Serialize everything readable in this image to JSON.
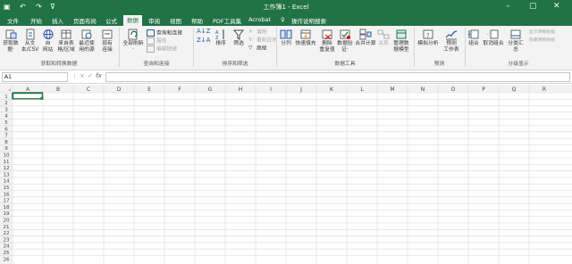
{
  "titlebar": {
    "title": "工作簿1 - Excel",
    "qat": [
      "save-icon",
      "undo-icon",
      "redo-icon",
      "customize-icon"
    ],
    "window_controls": [
      "minimize-icon",
      "restore-icon",
      "close-icon"
    ],
    "colors": {
      "accent": "#217346",
      "ribbon": "#f3f3f3"
    }
  },
  "tabs": [
    "文件",
    "开始",
    "插入",
    "页面布局",
    "公式",
    "数据",
    "审阅",
    "视图",
    "帮助",
    "PDF工具集",
    "Acrobat"
  ],
  "active_tab": "数据",
  "tell_me": "操作说明搜索",
  "ribbon": {
    "groups": {
      "get_transform": "获取和转换数据",
      "queries": "查询和连接",
      "sort_filter": "排序和筛选",
      "data_tools": "数据工具",
      "forecast": "预测",
      "outline": "分级显示"
    },
    "get_data": [
      "获取数",
      "据·"
    ],
    "from_text": [
      "从文",
      "本/CSV"
    ],
    "from_web": [
      "自",
      "网站"
    ],
    "from_table": [
      "来自表",
      "格/区域"
    ],
    "recent_sources": [
      "最近使",
      "用的源"
    ],
    "existing_conn": [
      "现有",
      "连接"
    ],
    "refresh_all": [
      "全部刷新",
      "·"
    ],
    "queries_conn": "查询和连接",
    "properties": "属性",
    "edit_links": "编辑链接",
    "sort": "排序",
    "filter": "筛选",
    "clear": "清除",
    "reapply": "重新应用",
    "advanced": "高级",
    "text_to_cols": "分列",
    "flash_fill": "快速填充",
    "remove_dup": [
      "删除",
      "重复值"
    ],
    "validation": [
      "数据验",
      "证·"
    ],
    "consolidate": "合并计算",
    "relationships": "关系",
    "data_model": [
      "管理数",
      "据模型"
    ],
    "what_if": "模拟分析",
    "forecast_sheet": [
      "预测",
      "工作表"
    ],
    "group": "组合",
    "ungroup": "取消组合",
    "subtotal": "分类汇总",
    "show_detail": "显示明细数据",
    "hide_detail": "隐藏明细数据"
  },
  "formula_bar": {
    "name_box": "A1",
    "cancel": "×",
    "enter": "✓",
    "fx": "fx",
    "value": ""
  },
  "sheet": {
    "columns": [
      "A",
      "B",
      "C",
      "D",
      "E",
      "F",
      "G",
      "H",
      "I",
      "J",
      "K",
      "L",
      "M",
      "N",
      "O",
      "P",
      "Q",
      "R"
    ],
    "rows": [
      "1",
      "2",
      "3",
      "4",
      "5",
      "6",
      "7",
      "8",
      "9",
      "10",
      "11",
      "12",
      "13",
      "14",
      "15",
      "16",
      "17",
      "18",
      "19",
      "20",
      "21",
      "22",
      "23",
      "24",
      "25",
      "26"
    ],
    "selected_cell": "A1"
  }
}
